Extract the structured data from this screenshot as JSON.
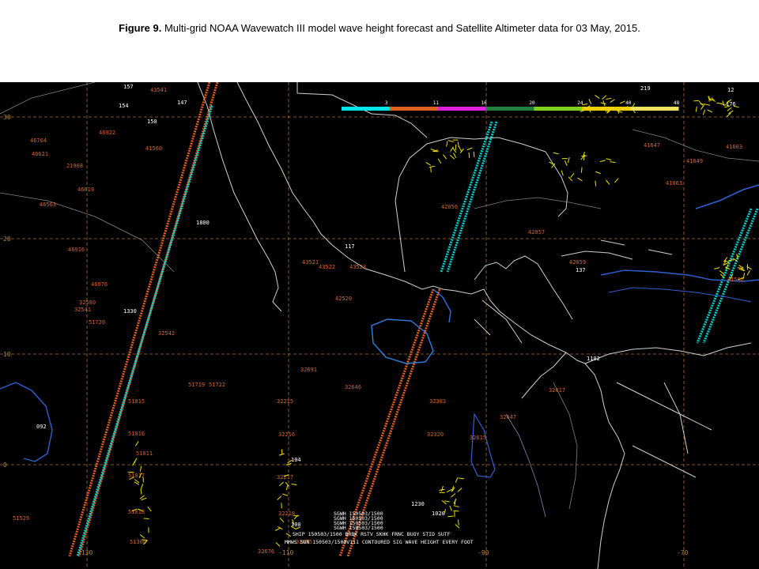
{
  "caption": {
    "prefix": "Figure 9.",
    "text": " Multi-grid NOAA Wavewatch III model wave height forecast and Satellite Altimeter data for 03 May, 2015."
  },
  "map": {
    "lat_labels": [
      "30",
      "20",
      "10",
      "0"
    ],
    "lon_labels": [
      "-130",
      "-110",
      "-90",
      "-70"
    ],
    "scale_ticks": [
      "3",
      "11",
      "16",
      "20",
      "24",
      "40",
      "48"
    ],
    "scale_colors": [
      "#00e5e5",
      "#e06020",
      "#e020e0",
      "#208040",
      "#80d020",
      "#f0d000",
      "#f0e060"
    ],
    "footer_lines": [
      "SHIP 150503/1500  BRBK RSTV  SKHK  FRNC  BUOY  STID  SUTF",
      "SGWH 150503/1500",
      "SGWH 150503/1500",
      "SGWH 150503/1500",
      "SGWH 150503/1500"
    ],
    "footer_title": "MMWS SUN 150503/1500V111 CONTOURED SIG WAVE HEIGHT EVERY FOOT",
    "stations": [
      {
        "t": "46764",
        "c": "#e06020"
      },
      {
        "t": "46621",
        "c": "#e06020"
      },
      {
        "t": "21908",
        "c": "#e06020"
      },
      {
        "t": "46619",
        "c": "#e06020"
      },
      {
        "t": "46563",
        "c": "#e06020"
      },
      {
        "t": "46916",
        "c": "#e06020"
      },
      {
        "t": "46922",
        "c": "#e06020"
      },
      {
        "t": "43541",
        "c": "#e06020"
      },
      {
        "t": "41560",
        "c": "#e06020"
      },
      {
        "t": "46976",
        "c": "#e06020"
      },
      {
        "t": "32580",
        "c": "#e06020"
      },
      {
        "t": "32541",
        "c": "#e06020"
      },
      {
        "t": "51720",
        "c": "#e06020"
      },
      {
        "t": "32542",
        "c": "#e06020"
      },
      {
        "t": "51719",
        "c": "#e06020"
      },
      {
        "t": "51722",
        "c": "#e06020"
      },
      {
        "t": "51015",
        "c": "#e06020"
      },
      {
        "t": "51016",
        "c": "#e06020"
      },
      {
        "t": "51011",
        "c": "#e06020"
      },
      {
        "t": "51017",
        "c": "#e06020"
      },
      {
        "t": "51529",
        "c": "#e06020"
      },
      {
        "t": "51018",
        "c": "#e06020"
      },
      {
        "t": "51300",
        "c": "#e06020"
      },
      {
        "t": "32676",
        "c": "#e06020"
      },
      {
        "t": "32675",
        "c": "#e06020"
      },
      {
        "t": "32215",
        "c": "#e06020"
      },
      {
        "t": "32216",
        "c": "#e06020"
      },
      {
        "t": "32217",
        "c": "#e06020"
      },
      {
        "t": "32218",
        "c": "#e06020"
      },
      {
        "t": "43521",
        "c": "#e06020"
      },
      {
        "t": "43522",
        "c": "#e06020"
      },
      {
        "t": "43523",
        "c": "#e06020"
      },
      {
        "t": "42520",
        "c": "#e06020"
      },
      {
        "t": "32691",
        "c": "#e06020"
      },
      {
        "t": "32646",
        "c": "#e06020"
      },
      {
        "t": "32617",
        "c": "#e06020"
      },
      {
        "t": "32647",
        "c": "#e06020"
      },
      {
        "t": "32615",
        "c": "#e06020"
      },
      {
        "t": "32320",
        "c": "#e06020"
      },
      {
        "t": "32303",
        "c": "#e06020"
      },
      {
        "t": "42056",
        "c": "#e06020"
      },
      {
        "t": "42057",
        "c": "#e06020"
      },
      {
        "t": "41647",
        "c": "#e06020"
      },
      {
        "t": "41603",
        "c": "#e06020"
      },
      {
        "t": "41649",
        "c": "#e06020"
      },
      {
        "t": "41063",
        "c": "#e06020"
      },
      {
        "t": "42059",
        "c": "#e06020"
      },
      {
        "t": "41562",
        "c": "#e06020"
      }
    ],
    "white_labels": [
      "157",
      "154",
      "150",
      "147",
      "1800",
      "1330",
      "117",
      "1230",
      "1020",
      "1102",
      "12",
      "176",
      "219",
      "104",
      "100",
      "092",
      "137"
    ]
  }
}
